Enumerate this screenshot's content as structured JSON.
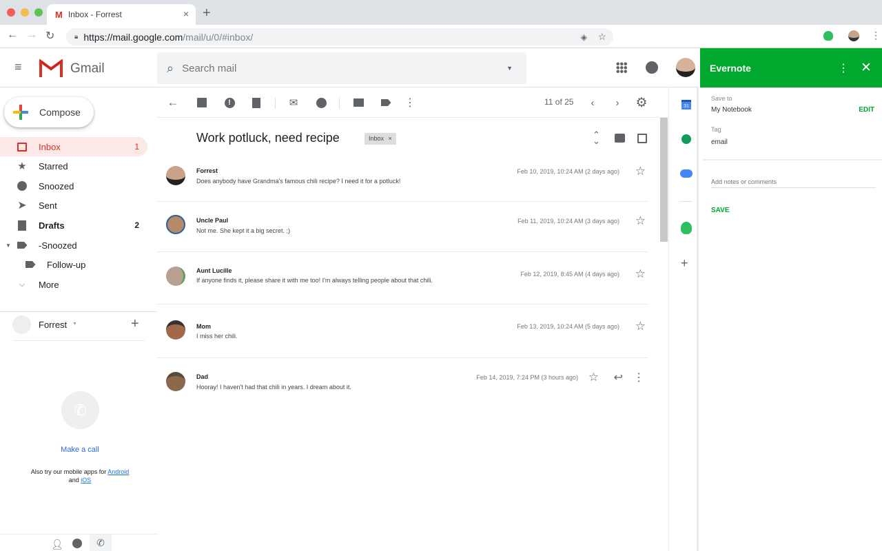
{
  "browser": {
    "tab_title": "Inbox - Forrest",
    "url_host": "https://mail.google.com",
    "url_path": "/mail/u/0/#inbox/"
  },
  "header": {
    "app_name": "Gmail",
    "search_placeholder": "Search mail"
  },
  "sidebar": {
    "compose_label": "Compose",
    "items": [
      {
        "label": "Inbox",
        "count": "1",
        "icon": "inbox-icon"
      },
      {
        "label": "Starred",
        "count": "",
        "icon": "star-icon"
      },
      {
        "label": "Snoozed",
        "count": "",
        "icon": "clock-icon"
      },
      {
        "label": "Sent",
        "count": "",
        "icon": "send-icon"
      },
      {
        "label": "Drafts",
        "count": "2",
        "icon": "draft-icon"
      },
      {
        "label": "-Snoozed",
        "count": "",
        "icon": "label-icon"
      },
      {
        "label": "Follow-up",
        "count": "",
        "icon": "label-icon"
      },
      {
        "label": "More",
        "count": "",
        "icon": "chevron-down-icon"
      }
    ],
    "account_name": "Forrest",
    "make_call": "Make a call",
    "mobile_text": "Also try our mobile apps for",
    "android": "Android",
    "and": "and",
    "ios": "iOS"
  },
  "toolbar": {
    "pagination": "11 of 25"
  },
  "thread": {
    "subject": "Work potluck, need recipe",
    "label_chip": "Inbox",
    "messages": [
      {
        "from": "Forrest",
        "body": "Does anybody have Grandma's famous chili recipe? I need it for a potluck!",
        "date": "Feb 10, 2019, 10:24 AM (2 days ago)"
      },
      {
        "from": "Uncle Paul",
        "body": "Not me. She kept it a big secret. ;)",
        "date": "Feb 11, 2019, 10:24 AM (3 days ago)"
      },
      {
        "from": "Aunt Lucille",
        "body": "If anyone finds it, please share it with me too! I'm always telling people about that chili.",
        "date": "Feb 12, 2019, 8:45 AM (4 days ago)"
      },
      {
        "from": "Mom",
        "body": "I miss her chili.",
        "date": "Feb 13, 2019, 10:24 AM (5 days ago)"
      },
      {
        "from": "Dad",
        "body": "Hooray! I haven't had that chili in years. I dream about it.",
        "date": "Feb 14, 2019, 7:24 PM (3 hours ago)"
      }
    ]
  },
  "evernote": {
    "title": "Evernote",
    "save_to_label": "Save to",
    "notebook": "My Notebook",
    "edit": "EDIT",
    "tag_label": "Tag",
    "tag": "email",
    "notes_placeholder": "Add notes or comments",
    "save": "SAVE",
    "brand_color": "#00a82d"
  }
}
